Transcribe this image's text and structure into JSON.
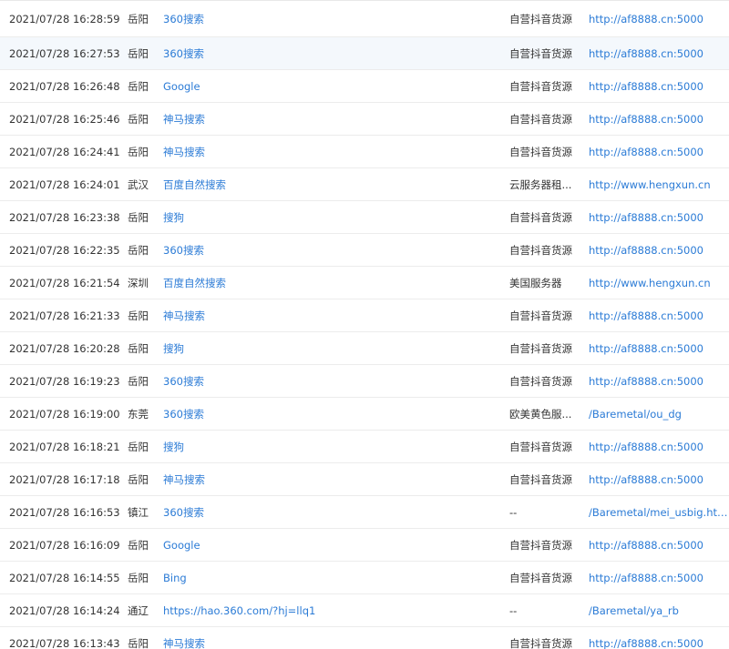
{
  "visits": {
    "rows": [
      {
        "time": "2021/07/28 16:28:59",
        "city": "岳阳",
        "source": "360搜索",
        "keyword": "自营抖音货源",
        "landing": "http://af8888.cn:5000"
      },
      {
        "time": "2021/07/28 16:27:53",
        "city": "岳阳",
        "source": "360搜索",
        "keyword": "自营抖音货源",
        "landing": "http://af8888.cn:5000"
      },
      {
        "time": "2021/07/28 16:26:48",
        "city": "岳阳",
        "source": "Google",
        "keyword": "自营抖音货源",
        "landing": "http://af8888.cn:5000"
      },
      {
        "time": "2021/07/28 16:25:46",
        "city": "岳阳",
        "source": "神马搜索",
        "keyword": "自营抖音货源",
        "landing": "http://af8888.cn:5000"
      },
      {
        "time": "2021/07/28 16:24:41",
        "city": "岳阳",
        "source": "神马搜索",
        "keyword": "自营抖音货源",
        "landing": "http://af8888.cn:5000"
      },
      {
        "time": "2021/07/28 16:24:01",
        "city": "武汉",
        "source": "百度自然搜索",
        "keyword": "云服务器租...",
        "landing": "http://www.hengxun.cn"
      },
      {
        "time": "2021/07/28 16:23:38",
        "city": "岳阳",
        "source": "搜狗",
        "keyword": "自营抖音货源",
        "landing": "http://af8888.cn:5000"
      },
      {
        "time": "2021/07/28 16:22:35",
        "city": "岳阳",
        "source": "360搜索",
        "keyword": "自营抖音货源",
        "landing": "http://af8888.cn:5000"
      },
      {
        "time": "2021/07/28 16:21:54",
        "city": "深圳",
        "source": "百度自然搜索",
        "keyword": "美国服务器",
        "landing": "http://www.hengxun.cn"
      },
      {
        "time": "2021/07/28 16:21:33",
        "city": "岳阳",
        "source": "神马搜索",
        "keyword": "自营抖音货源",
        "landing": "http://af8888.cn:5000"
      },
      {
        "time": "2021/07/28 16:20:28",
        "city": "岳阳",
        "source": "搜狗",
        "keyword": "自营抖音货源",
        "landing": "http://af8888.cn:5000"
      },
      {
        "time": "2021/07/28 16:19:23",
        "city": "岳阳",
        "source": "360搜索",
        "keyword": "自营抖音货源",
        "landing": "http://af8888.cn:5000"
      },
      {
        "time": "2021/07/28 16:19:00",
        "city": "东莞",
        "source": "360搜索",
        "keyword": "欧美黄色服...",
        "landing": "/Baremetal/ou_dg"
      },
      {
        "time": "2021/07/28 16:18:21",
        "city": "岳阳",
        "source": "搜狗",
        "keyword": "自营抖音货源",
        "landing": "http://af8888.cn:5000"
      },
      {
        "time": "2021/07/28 16:17:18",
        "city": "岳阳",
        "source": "神马搜索",
        "keyword": "自营抖音货源",
        "landing": "http://af8888.cn:5000"
      },
      {
        "time": "2021/07/28 16:16:53",
        "city": "镇江",
        "source": "360搜索",
        "keyword": "--",
        "landing": "/Baremetal/mei_usbig.html"
      },
      {
        "time": "2021/07/28 16:16:09",
        "city": "岳阳",
        "source": "Google",
        "keyword": "自营抖音货源",
        "landing": "http://af8888.cn:5000"
      },
      {
        "time": "2021/07/28 16:14:55",
        "city": "岳阳",
        "source": "Bing",
        "keyword": "自营抖音货源",
        "landing": "http://af8888.cn:5000"
      },
      {
        "time": "2021/07/28 16:14:24",
        "city": "通辽",
        "source": "https://hao.360.com/?hj=llq1",
        "keyword": "--",
        "landing": "/Baremetal/ya_rb"
      },
      {
        "time": "2021/07/28 16:13:43",
        "city": "岳阳",
        "source": "神马搜索",
        "keyword": "自营抖音货源",
        "landing": "http://af8888.cn:5000"
      }
    ]
  }
}
